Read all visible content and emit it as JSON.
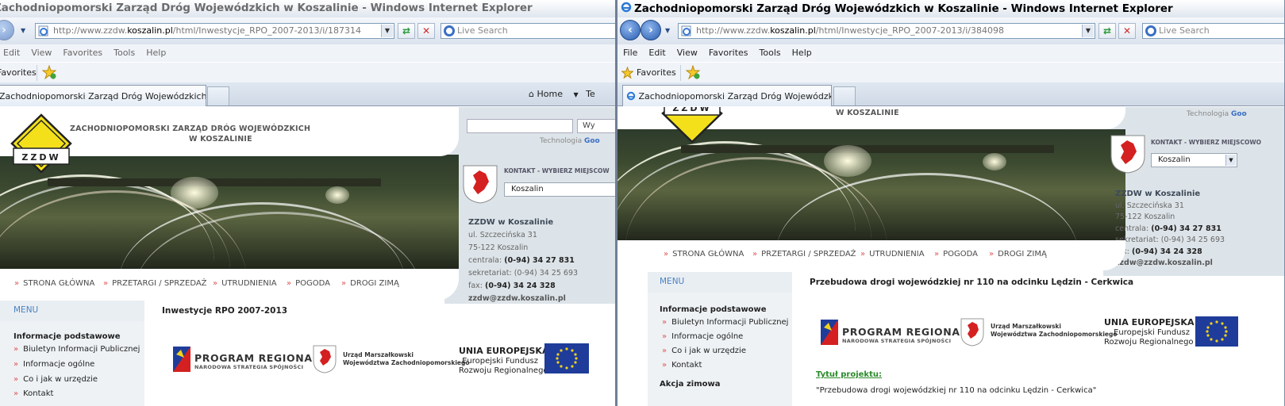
{
  "left_window": {
    "title": "Zachodniopomorski Zarząd Dróg Wojewódzkich w Koszalinie - Windows Internet Explorer",
    "address": {
      "prefix": "http://www.zzdw.",
      "domain": "koszalin.pl",
      "path": "/html/Inwestycje_RPO_2007-2013/i/187314"
    },
    "search_placeholder": "Live Search",
    "menu": [
      "Edit",
      "View",
      "Favorites",
      "Tools",
      "Help"
    ],
    "favorites_label": "Favorites",
    "tab_title": "Zachodniopomorski Zarząd Dróg Wojewódzkich w Kos...",
    "home_label": "Home",
    "home_extra": "Te",
    "page": {
      "header_line1": "ZACHODNIOPOMORSKI ZARZĄD DRÓG WOJEWÓDZKICH",
      "header_line2": "W KOSZALINIE",
      "logo_text": "ZZDW",
      "search_button_partial": "Wy",
      "technologia": "Technologia",
      "google": "Goo",
      "kontakt_label": "KONTAKT - WYBIERZ MIEJSCOW",
      "location_select": "Koszalin",
      "contact": {
        "name": "ZZDW w Koszalinie",
        "street": "ul. Szczecińska 31",
        "city": "75-122 Koszalin",
        "centrala_label": "centrala:",
        "centrala": "(0-94) 34 27 831",
        "sekretariat": "sekretariat: (0-94) 34 25 693",
        "fax_label": "fax:",
        "fax": "(0-94) 34 24 328",
        "email": "zzdw@zzdw.koszalin.pl"
      },
      "nav": [
        "STRONA GŁÓWNA",
        "PRZETARGI / SPRZEDAŻ",
        "UTRUDNIENIA",
        "POGODA",
        "DROGI ZIMĄ"
      ],
      "menu_heading": "MENU",
      "menu_section": "Informacje podstawowe",
      "menu_items": [
        "Biuletyn Informacji Publicznej",
        "Informacje ogólne",
        "Co i jak w urzędzie",
        "Kontakt"
      ],
      "page_title": "Inwestycje RPO 2007-2013",
      "program_regionalny": "PROGRAM REGIONALNY",
      "program_sub": "NARODOWA STRATEGIA SPÓJNOŚCI",
      "urzad_line1": "Urząd Marszałkowski",
      "urzad_line2": "Województwa Zachodniopomorskiego",
      "ue_title": "UNIA EUROPEJSKA",
      "ue_line1": "Europejski Fundusz",
      "ue_line2": "Rozwoju Regionalnego"
    }
  },
  "right_window": {
    "title": "Zachodniopomorski Zarząd Dróg Wojewódzkich w Koszalinie - Windows Internet Explorer",
    "address": {
      "prefix": "http://www.zzdw.",
      "domain": "koszalin.pl",
      "path": "/html/Inwestycje_RPO_2007-2013/i/384098"
    },
    "search_placeholder": "Live Search",
    "menu": [
      "File",
      "Edit",
      "View",
      "Favorites",
      "Tools",
      "Help"
    ],
    "favorites_label": "Favorites",
    "tab_title": "Zachodniopomorski Zarząd Dróg Wojewódzkich w Kos...",
    "page": {
      "header_line2": "W KOSZALINIE",
      "logo_text": "ZZDW",
      "technologia": "Technologia",
      "google": "Goo",
      "kontakt_label": "KONTAKT - WYBIERZ MIEJSCOWO",
      "location_select": "Koszalin",
      "contact": {
        "name": "ZZDW w Koszalinie",
        "street": "ul. Szczecińska 31",
        "city": "75-122 Koszalin",
        "centrala_label": "centrala:",
        "centrala": "(0-94) 34 27 831",
        "sekretariat": "sekretariat: (0-94) 34 25 693",
        "fax_label": "fax:",
        "fax": "(0-94) 34 24 328",
        "email": "zzdw@zzdw.koszalin.pl"
      },
      "nav": [
        "STRONA GŁÓWNA",
        "PRZETARGI / SPRZEDAŻ",
        "UTRUDNIENIA",
        "POGODA",
        "DROGI ZIMĄ"
      ],
      "menu_heading": "MENU",
      "menu_section": "Informacje podstawowe",
      "menu_items": [
        "Biuletyn Informacji Publicznej",
        "Informacje ogólne",
        "Co i jak w urzędzie",
        "Kontakt"
      ],
      "menu_section2": "Akcja zimowa",
      "page_title": "Przebudowa drogi wojewódzkiej nr 110 na odcinku Lędzin - Cerkwica",
      "program_regionalny": "PROGRAM REGIONALNY",
      "program_sub": "NARODOWA STRATEGIA SPÓJNOŚCI",
      "urzad_line1": "Urząd Marszałkowski",
      "urzad_line2": "Województwa Zachodniopomorskiego",
      "ue_title": "UNIA EUROPEJSKA",
      "ue_line1": "Europejski Fundusz",
      "ue_line2": "Rozwoju Regionalnego",
      "tytul_label": "Tytuł projektu:",
      "project_title": "\"Przebudowa drogi wojewódzkiej nr 110 na odcinku Lędzin - Cerkwica\""
    }
  },
  "colors": {
    "menu_heading": "#4c82c2",
    "nav_arrow": "#e05050",
    "eu_blue": "#1f3c9a",
    "tytul": "#2a8a2a"
  }
}
